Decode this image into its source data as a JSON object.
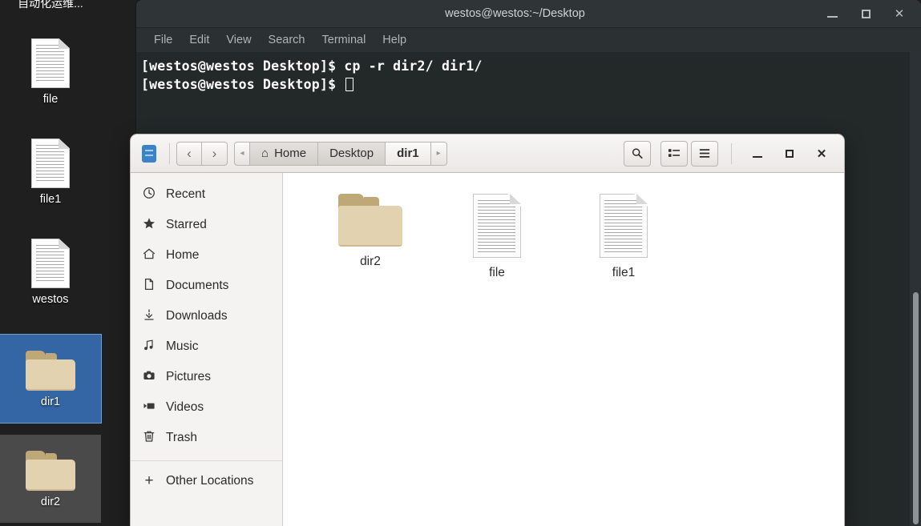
{
  "desktop": {
    "top_label": "自动化运维...",
    "icons": [
      {
        "name": "file",
        "type": "document",
        "selected": false
      },
      {
        "name": "file1",
        "type": "document",
        "selected": false
      },
      {
        "name": "westos",
        "type": "document",
        "selected": false
      },
      {
        "name": "dir1",
        "type": "folder",
        "selected": true
      },
      {
        "name": "dir2",
        "type": "folder",
        "selected": false,
        "secondary": true
      }
    ],
    "selection_color": "#3465a4",
    "background_color": "#201f1f"
  },
  "terminal": {
    "title": "westos@westos:~/Desktop",
    "menu": [
      "File",
      "Edit",
      "View",
      "Search",
      "Terminal",
      "Help"
    ],
    "lines": [
      "[westos@westos Desktop]$ cp -r dir2/ dir1/",
      "[westos@westos Desktop]$ "
    ],
    "window_controls": {
      "minimize": "—",
      "maximize": "□",
      "close": "✕"
    },
    "background_color": "#232829",
    "text_color": "#ffffff"
  },
  "filemanager": {
    "app_icon": "files-app-icon",
    "nav": {
      "back": "‹",
      "forward": "›"
    },
    "breadcrumb": {
      "left_arrow": "◂",
      "right_arrow": "▸",
      "items": [
        {
          "label": "Home",
          "icon": "home-icon",
          "current": false
        },
        {
          "label": "Desktop",
          "icon": "",
          "current": false
        },
        {
          "label": "dir1",
          "icon": "",
          "current": true
        }
      ]
    },
    "toolbar": {
      "search_label": "⌕",
      "view_grid_label": "view-grid",
      "menu_label": "≡"
    },
    "window_controls": {
      "minimize": "—",
      "maximize": "□",
      "close": "✕"
    },
    "sidebar": {
      "items": [
        {
          "label": "Recent",
          "icon": "clock-icon",
          "glyph": "◔"
        },
        {
          "label": "Starred",
          "icon": "star-icon",
          "glyph": "★"
        },
        {
          "label": "Home",
          "icon": "home-icon",
          "glyph": "⌂"
        },
        {
          "label": "Documents",
          "icon": "document-icon",
          "glyph": "🗎"
        },
        {
          "label": "Downloads",
          "icon": "download-icon",
          "glyph": "↓"
        },
        {
          "label": "Music",
          "icon": "music-icon",
          "glyph": "♫"
        },
        {
          "label": "Pictures",
          "icon": "camera-icon",
          "glyph": "▣"
        },
        {
          "label": "Videos",
          "icon": "video-icon",
          "glyph": "▶"
        },
        {
          "label": "Trash",
          "icon": "trash-icon",
          "glyph": "🗑"
        }
      ],
      "other_locations": {
        "label": "Other Locations",
        "icon": "plus-icon",
        "glyph": "+"
      }
    },
    "files": [
      {
        "name": "dir2",
        "type": "folder"
      },
      {
        "name": "file",
        "type": "document"
      },
      {
        "name": "file1",
        "type": "document"
      }
    ]
  }
}
